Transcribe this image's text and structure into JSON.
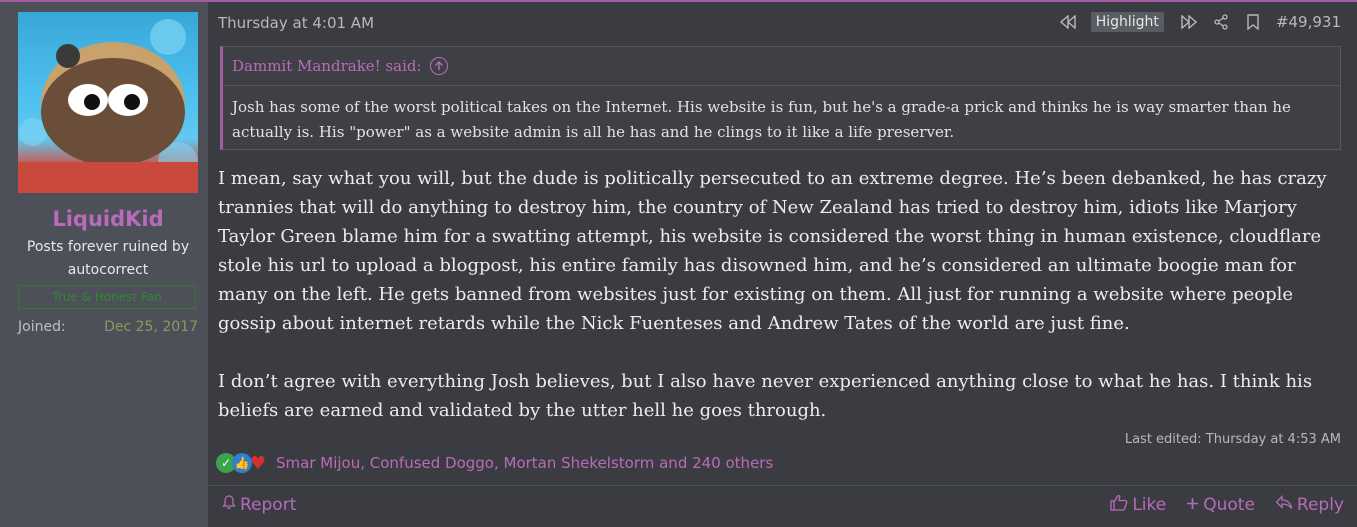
{
  "user": {
    "username": "LiquidKid",
    "title": "Posts forever ruined by autocorrect",
    "banner": "True & Honest Fan",
    "joined_label": "Joined:",
    "joined_value": "Dec 25, 2017"
  },
  "post": {
    "date": "Thursday at 4:01 AM",
    "highlight_label": "Highlight",
    "post_number": "#49,931",
    "quote": {
      "author": "Dammit Mandrake! said:",
      "text": "Josh has some of the worst political takes on the Internet. His website is fun, but he's a grade-a prick and thinks he is way smarter than he actually is. His \"power\" as a website admin is all he has and he clings to it like a life preserver."
    },
    "paragraphs": [
      "I mean, say what you will, but the dude is politically persecuted to an extreme degree. He’s been debanked, he has crazy trannies that will do anything to destroy him, the country of New Zealand has tried to destroy him, idiots like Marjory Taylor Green blame him for a swatting attempt, his website is considered the worst thing in human existence, cloudflare stole his url to upload a blogpost, his entire family has disowned him, and he’s considered an ultimate boogie man for many on the left. He gets banned from websites just for existing on them. All just for running a website where people gossip about internet retards while the Nick Fuenteses and Andrew Tates of the world are just fine.",
      "I don’t agree with everything Josh believes, but I also have never experienced anything close to what he has. I think his beliefs are earned and validated by the utter hell he goes through."
    ],
    "last_edited": "Last edited: Thursday at 4:53 AM",
    "reactions_text": "Smar Mijou, Confused Doggo, Mortan Shekelstorm and 240 others"
  },
  "footer": {
    "report": "Report",
    "like": "Like",
    "quote": "Quote",
    "reply": "Reply"
  },
  "icons": {
    "prev": "rewind-icon",
    "next": "fast-forward-icon",
    "share": "share-icon",
    "bookmark": "bookmark-icon",
    "quote_up": "arrow-up-circle-icon",
    "report": "bell-icon",
    "like": "thumbs-up-icon",
    "quote_btn": "plus-icon",
    "reply": "reply-icon"
  },
  "colors": {
    "accent": "#b86bb8",
    "background": "#3a3c42",
    "sidebar": "#4d5058",
    "banner": "#2f8a2f"
  }
}
